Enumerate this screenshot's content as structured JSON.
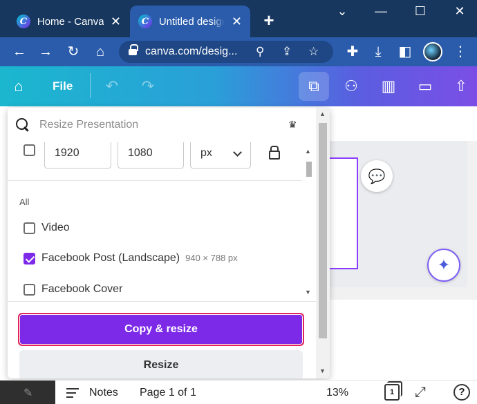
{
  "browser": {
    "tabs": [
      {
        "title": "Home - Canva",
        "close": "✕"
      },
      {
        "title": "Untitled design",
        "close": "✕"
      }
    ],
    "new_tab": "+",
    "window_controls": {
      "chevron": "⌄",
      "minimize": "—",
      "maximize": "☐",
      "close": "✕"
    },
    "url": "canva.com/desig...",
    "icons": [
      "back-icon",
      "forward-icon",
      "reload-icon",
      "home-icon",
      "lock-icon",
      "zoom-icon",
      "share-icon",
      "star-icon",
      "extensions-icon",
      "download-icon",
      "sidepanel-icon",
      "profile-avatar",
      "menu-icon"
    ]
  },
  "canva_toolbar": {
    "file_label": "File",
    "icons": [
      "home-icon",
      "undo-icon",
      "redo-icon",
      "resize-icon",
      "share-people-icon",
      "insights-icon",
      "present-icon",
      "upload-icon"
    ]
  },
  "resize_panel": {
    "search_placeholder": "Resize Presentation",
    "custom_size": {
      "width": "1920",
      "height": "1080",
      "unit": "px",
      "checked": false
    },
    "section_label": "All",
    "options": [
      {
        "label": "Video",
        "dims": "",
        "checked": false
      },
      {
        "label": "Facebook Post (Landscape)",
        "dims": "940 × 788 px",
        "checked": true
      },
      {
        "label": "Facebook Cover",
        "dims": "",
        "checked": false
      }
    ],
    "copy_resize_label": "Copy & resize",
    "resize_label": "Resize"
  },
  "footer": {
    "notes_label": "Notes",
    "page_label": "Page 1 of 1",
    "zoom": "13%",
    "pages_count": "1",
    "help": "?"
  },
  "colors": {
    "browser_tabstrip": "#17375e",
    "browser_active": "#2a5cab",
    "canva_purple": "#7d2ae8",
    "highlight_border": "#e0245e"
  }
}
